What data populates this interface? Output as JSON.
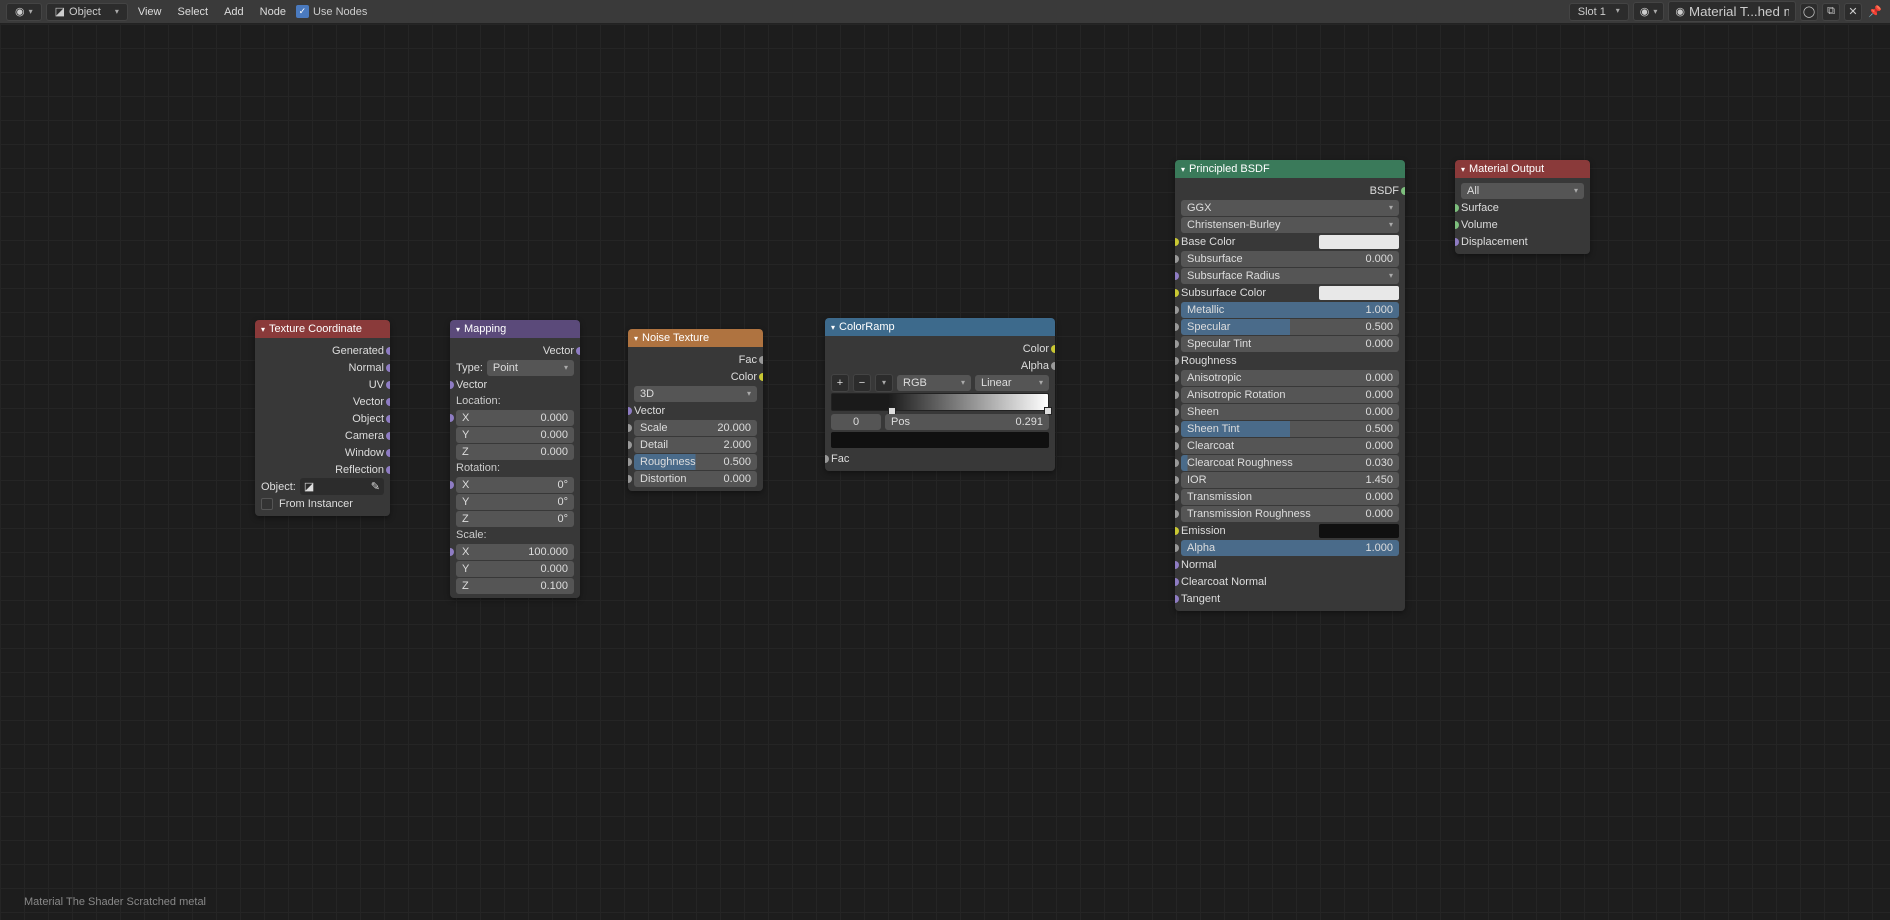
{
  "header": {
    "mode": "Object",
    "menus": [
      "View",
      "Select",
      "Add",
      "Node"
    ],
    "use_nodes_label": "Use Nodes",
    "slot": "Slot 1",
    "material_name": "Material T...hed metal"
  },
  "footer": "Material The Shader Scratched metal",
  "nodes": {
    "texcoord": {
      "title": "Texture Coordinate",
      "outputs": [
        "Generated",
        "Normal",
        "UV",
        "Vector",
        "Object",
        "Camera",
        "Window",
        "Reflection"
      ],
      "object_label": "Object:",
      "from_instancer": "From Instancer"
    },
    "mapping": {
      "title": "Mapping",
      "out_vector": "Vector",
      "type_label": "Type:",
      "type_value": "Point",
      "in_vector": "Vector",
      "location_label": "Location:",
      "loc_x": "0.000",
      "loc_y": "0.000",
      "loc_z": "0.000",
      "rotation_label": "Rotation:",
      "rot_x": "0°",
      "rot_y": "0°",
      "rot_z": "0°",
      "scale_label": "Scale:",
      "sc_x": "100.000",
      "sc_y": "0.000",
      "sc_z": "0.100"
    },
    "noise": {
      "title": "Noise Texture",
      "out_fac": "Fac",
      "out_color": "Color",
      "dim": "3D",
      "in_vector": "Vector",
      "scale_l": "Scale",
      "scale_v": "20.000",
      "detail_l": "Detail",
      "detail_v": "2.000",
      "rough_l": "Roughness",
      "rough_v": "0.500",
      "dist_l": "Distortion",
      "dist_v": "0.000"
    },
    "ramp": {
      "title": "ColorRamp",
      "out_color": "Color",
      "out_alpha": "Alpha",
      "mode": "RGB",
      "interp": "Linear",
      "pos0": "0",
      "pos_l": "Pos",
      "pos_v": "0.291",
      "in_fac": "Fac"
    },
    "bsdf": {
      "title": "Principled BSDF",
      "out": "BSDF",
      "dist": "GGX",
      "sss": "Christensen-Burley",
      "rows": [
        {
          "l": "Base Color",
          "swatch": "#e8e8e8",
          "sock": "yellow"
        },
        {
          "l": "Subsurface",
          "v": "0.000",
          "sock": "gray"
        },
        {
          "l": "Subsurface Radius",
          "dd": true,
          "sock": "purple"
        },
        {
          "l": "Subsurface Color",
          "swatch": "#e8e8e8",
          "sock": "yellow"
        },
        {
          "l": "Metallic",
          "v": "1.000",
          "fill": 100,
          "sock": "gray"
        },
        {
          "l": "Specular",
          "v": "0.500",
          "fill": 50,
          "sock": "gray"
        },
        {
          "l": "Specular Tint",
          "v": "0.000",
          "sock": "gray"
        },
        {
          "l": "Roughness",
          "sock": "gray"
        },
        {
          "l": "Anisotropic",
          "v": "0.000",
          "sock": "gray"
        },
        {
          "l": "Anisotropic Rotation",
          "v": "0.000",
          "sock": "gray"
        },
        {
          "l": "Sheen",
          "v": "0.000",
          "sock": "gray"
        },
        {
          "l": "Sheen Tint",
          "v": "0.500",
          "fill": 50,
          "sock": "gray"
        },
        {
          "l": "Clearcoat",
          "v": "0.000",
          "sock": "gray"
        },
        {
          "l": "Clearcoat Roughness",
          "v": "0.030",
          "fill": 3,
          "sock": "gray"
        },
        {
          "l": "IOR",
          "v": "1.450",
          "sock": "gray"
        },
        {
          "l": "Transmission",
          "v": "0.000",
          "sock": "gray"
        },
        {
          "l": "Transmission Roughness",
          "v": "0.000",
          "sock": "gray"
        },
        {
          "l": "Emission",
          "swatch": "#101010",
          "sock": "yellow"
        },
        {
          "l": "Alpha",
          "v": "1.000",
          "fill": 100,
          "sock": "gray"
        },
        {
          "l": "Normal",
          "sock": "purple"
        },
        {
          "l": "Clearcoat Normal",
          "sock": "purple"
        },
        {
          "l": "Tangent",
          "sock": "purple"
        }
      ]
    },
    "output": {
      "title": "Material Output",
      "target": "All",
      "inputs": [
        {
          "l": "Surface",
          "sock": "green"
        },
        {
          "l": "Volume",
          "sock": "green"
        },
        {
          "l": "Displacement",
          "sock": "purple"
        }
      ]
    }
  }
}
